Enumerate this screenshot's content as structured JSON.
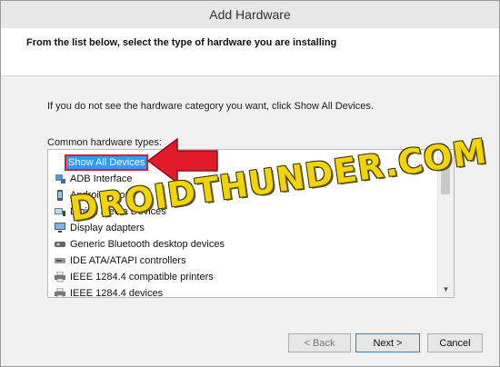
{
  "window": {
    "title": "Add Hardware"
  },
  "header": {
    "instruction": "From the list below, select the type of hardware you are installing"
  },
  "main": {
    "hint": "If you do not see the hardware category you want, click Show All Devices.",
    "list_label": "Common hardware types:",
    "items": [
      {
        "label": "Show All Devices",
        "icon": "none",
        "selected": true
      },
      {
        "label": "ADB Interface",
        "icon": "device-icon"
      },
      {
        "label": "Android Phone",
        "icon": "phone-icon"
      },
      {
        "label": "Digital Media Devices",
        "icon": "media-icon"
      },
      {
        "label": "Display adapters",
        "icon": "display-icon"
      },
      {
        "label": "Generic Bluetooth desktop devices",
        "icon": "bluetooth-icon"
      },
      {
        "label": "IDE ATA/ATAPI controllers",
        "icon": "drive-icon"
      },
      {
        "label": "IEEE 1284.4 compatible printers",
        "icon": "printer-icon"
      },
      {
        "label": "IEEE 1284.4 devices",
        "icon": "printer-icon"
      }
    ]
  },
  "buttons": {
    "back": "< Back",
    "next": "Next >",
    "cancel": "Cancel"
  },
  "watermark": "DROIDTHUNDER.COM",
  "colors": {
    "selection": "#3399ff",
    "annotation_red": "#e21b2b",
    "watermark": "#f1d400"
  }
}
